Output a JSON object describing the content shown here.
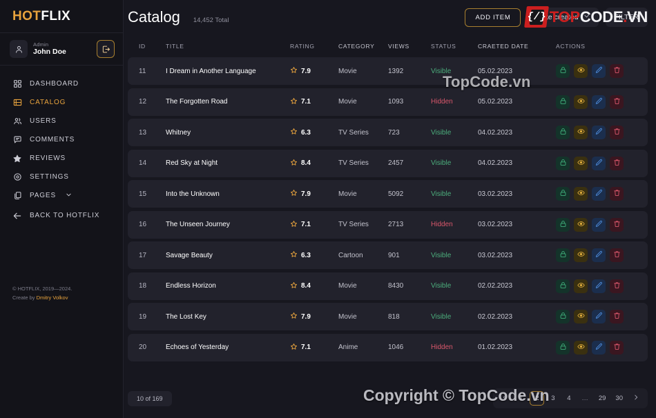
{
  "brand": {
    "part1": "HOT",
    "part2": "FLIX"
  },
  "profile": {
    "role": "Admin",
    "name": "John Doe",
    "logout_icon": "logout-icon",
    "avatar_icon": "user-icon"
  },
  "sidebar": {
    "items": [
      {
        "label": "Dashboard",
        "icon": "grid-icon",
        "active": false
      },
      {
        "label": "Catalog",
        "icon": "film-icon",
        "active": true
      },
      {
        "label": "Users",
        "icon": "users-icon",
        "active": false
      },
      {
        "label": "Comments",
        "icon": "comment-icon",
        "active": false
      },
      {
        "label": "Reviews",
        "icon": "star-icon",
        "active": false
      },
      {
        "label": "Settings",
        "icon": "gear-icon",
        "active": false
      },
      {
        "label": "Pages",
        "icon": "pages-icon",
        "active": false,
        "chevron": true
      },
      {
        "label": "Back to Hotflix",
        "icon": "arrow-left-icon",
        "active": false
      }
    ],
    "footer": {
      "copyright": "© HOTFLIX, 2019—2024.",
      "create_by_prefix": "Create by",
      "author": "Dmitry Volkov"
    }
  },
  "header": {
    "title": "Catalog",
    "total": "14,452 Total",
    "add_item_label": "ADD ITEM",
    "sort_label": "Date created",
    "filter_label": "FILTER"
  },
  "table": {
    "columns": [
      "ID",
      "TITLE",
      "RATING",
      "CATEGORY",
      "VIEWS",
      "STATUS",
      "CRAETED DATE",
      "ACTIONS"
    ],
    "rows": [
      {
        "id": "11",
        "title": "I Dream in Another Language",
        "rating": "7.9",
        "category": "Movie",
        "views": "1392",
        "status": "Visible",
        "date": "05.02.2023"
      },
      {
        "id": "12",
        "title": "The Forgotten Road",
        "rating": "7.1",
        "category": "Movie",
        "views": "1093",
        "status": "Hidden",
        "date": "05.02.2023"
      },
      {
        "id": "13",
        "title": "Whitney",
        "rating": "6.3",
        "category": "TV Series",
        "views": "723",
        "status": "Visible",
        "date": "04.02.2023"
      },
      {
        "id": "14",
        "title": "Red Sky at Night",
        "rating": "8.4",
        "category": "TV Series",
        "views": "2457",
        "status": "Visible",
        "date": "04.02.2023"
      },
      {
        "id": "15",
        "title": "Into the Unknown",
        "rating": "7.9",
        "category": "Movie",
        "views": "5092",
        "status": "Visible",
        "date": "03.02.2023"
      },
      {
        "id": "16",
        "title": "The Unseen Journey",
        "rating": "7.1",
        "category": "TV Series",
        "views": "2713",
        "status": "Hidden",
        "date": "03.02.2023"
      },
      {
        "id": "17",
        "title": "Savage Beauty",
        "rating": "6.3",
        "category": "Cartoon",
        "views": "901",
        "status": "Visible",
        "date": "03.02.2023"
      },
      {
        "id": "18",
        "title": "Endless Horizon",
        "rating": "8.4",
        "category": "Movie",
        "views": "8430",
        "status": "Visible",
        "date": "02.02.2023"
      },
      {
        "id": "19",
        "title": "The Lost Key",
        "rating": "7.9",
        "category": "Movie",
        "views": "818",
        "status": "Visible",
        "date": "02.02.2023"
      },
      {
        "id": "20",
        "title": "Echoes of Yesterday",
        "rating": "7.1",
        "category": "Anime",
        "views": "1046",
        "status": "Hidden",
        "date": "01.02.2023"
      }
    ],
    "row_actions": [
      "lock-icon",
      "eye-icon",
      "edit-icon",
      "trash-icon"
    ]
  },
  "footer": {
    "count": "10 of 169",
    "pagination": {
      "prev_icon": "chevron-left-icon",
      "next_icon": "chevron-right-icon",
      "pages": [
        "1",
        "2",
        "3",
        "4",
        "…",
        "29",
        "30"
      ],
      "active": "2"
    }
  },
  "watermarks": {
    "table": "TopCode.vn",
    "footer": "Copyright © TopCode.vn",
    "logo": {
      "brace": "{/}",
      "t1": "TOP",
      "t2": "CODE",
      "t3": ".",
      "t4": "VN"
    }
  },
  "colors": {
    "accent": "#e8a33d",
    "page_bg": "#17171f",
    "sidebar_bg": "#131319",
    "row_bg": "#22222c",
    "status_visible": "#4caf7d",
    "status_hidden": "#d9576b",
    "watermark_red": "#cc1f1f"
  }
}
